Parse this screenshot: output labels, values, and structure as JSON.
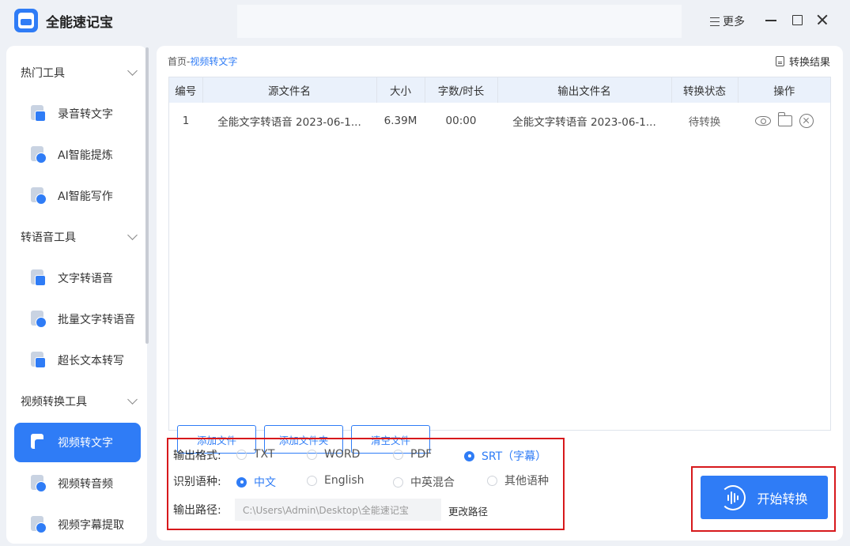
{
  "app": {
    "title": "全能速记宝",
    "more_label": "更多"
  },
  "sidebar": {
    "groups": [
      {
        "label": "热门工具",
        "items": [
          {
            "label": "录音转文字"
          },
          {
            "label": "AI智能提炼"
          },
          {
            "label": "AI智能写作"
          }
        ]
      },
      {
        "label": "转语音工具",
        "items": [
          {
            "label": "文字转语音"
          },
          {
            "label": "批量文字转语音"
          },
          {
            "label": "超长文本转写"
          }
        ]
      },
      {
        "label": "视频转换工具",
        "items": [
          {
            "label": "视频转文字",
            "active": true
          },
          {
            "label": "视频转音频"
          },
          {
            "label": "视频字幕提取"
          }
        ]
      }
    ]
  },
  "breadcrumb": {
    "home": "首页",
    "sep": "-",
    "current": "视频转文字"
  },
  "result_link": "转换结果",
  "table": {
    "headers": [
      "编号",
      "源文件名",
      "大小",
      "字数/时长",
      "输出文件名",
      "转换状态",
      "操作"
    ],
    "rows": [
      {
        "no": "1",
        "source": "全能文字转语音 2023-06-1...",
        "size": "6.39M",
        "duration": "00:00",
        "output": "全能文字转语音 2023-06-1...",
        "status": "待转换"
      }
    ]
  },
  "file_buttons": {
    "add_file": "添加文件",
    "add_folder": "添加文件夹",
    "clear": "清空文件"
  },
  "options": {
    "format_label": "输出格式:",
    "formats": [
      "TXT",
      "WORD",
      "PDF",
      "SRT（字幕）"
    ],
    "format_selected": "SRT（字幕）",
    "language_label": "识别语种:",
    "languages": [
      "中文",
      "English",
      "中英混合",
      "其他语种"
    ],
    "language_selected": "中文",
    "path_label": "输出路径:",
    "path_value": "C:\\Users\\Admin\\Desktop\\全能速记宝",
    "change_path": "更改路径"
  },
  "start_button": "开始转换",
  "colors": {
    "accent": "#2f7cf6",
    "highlight_border": "#d7191c"
  }
}
